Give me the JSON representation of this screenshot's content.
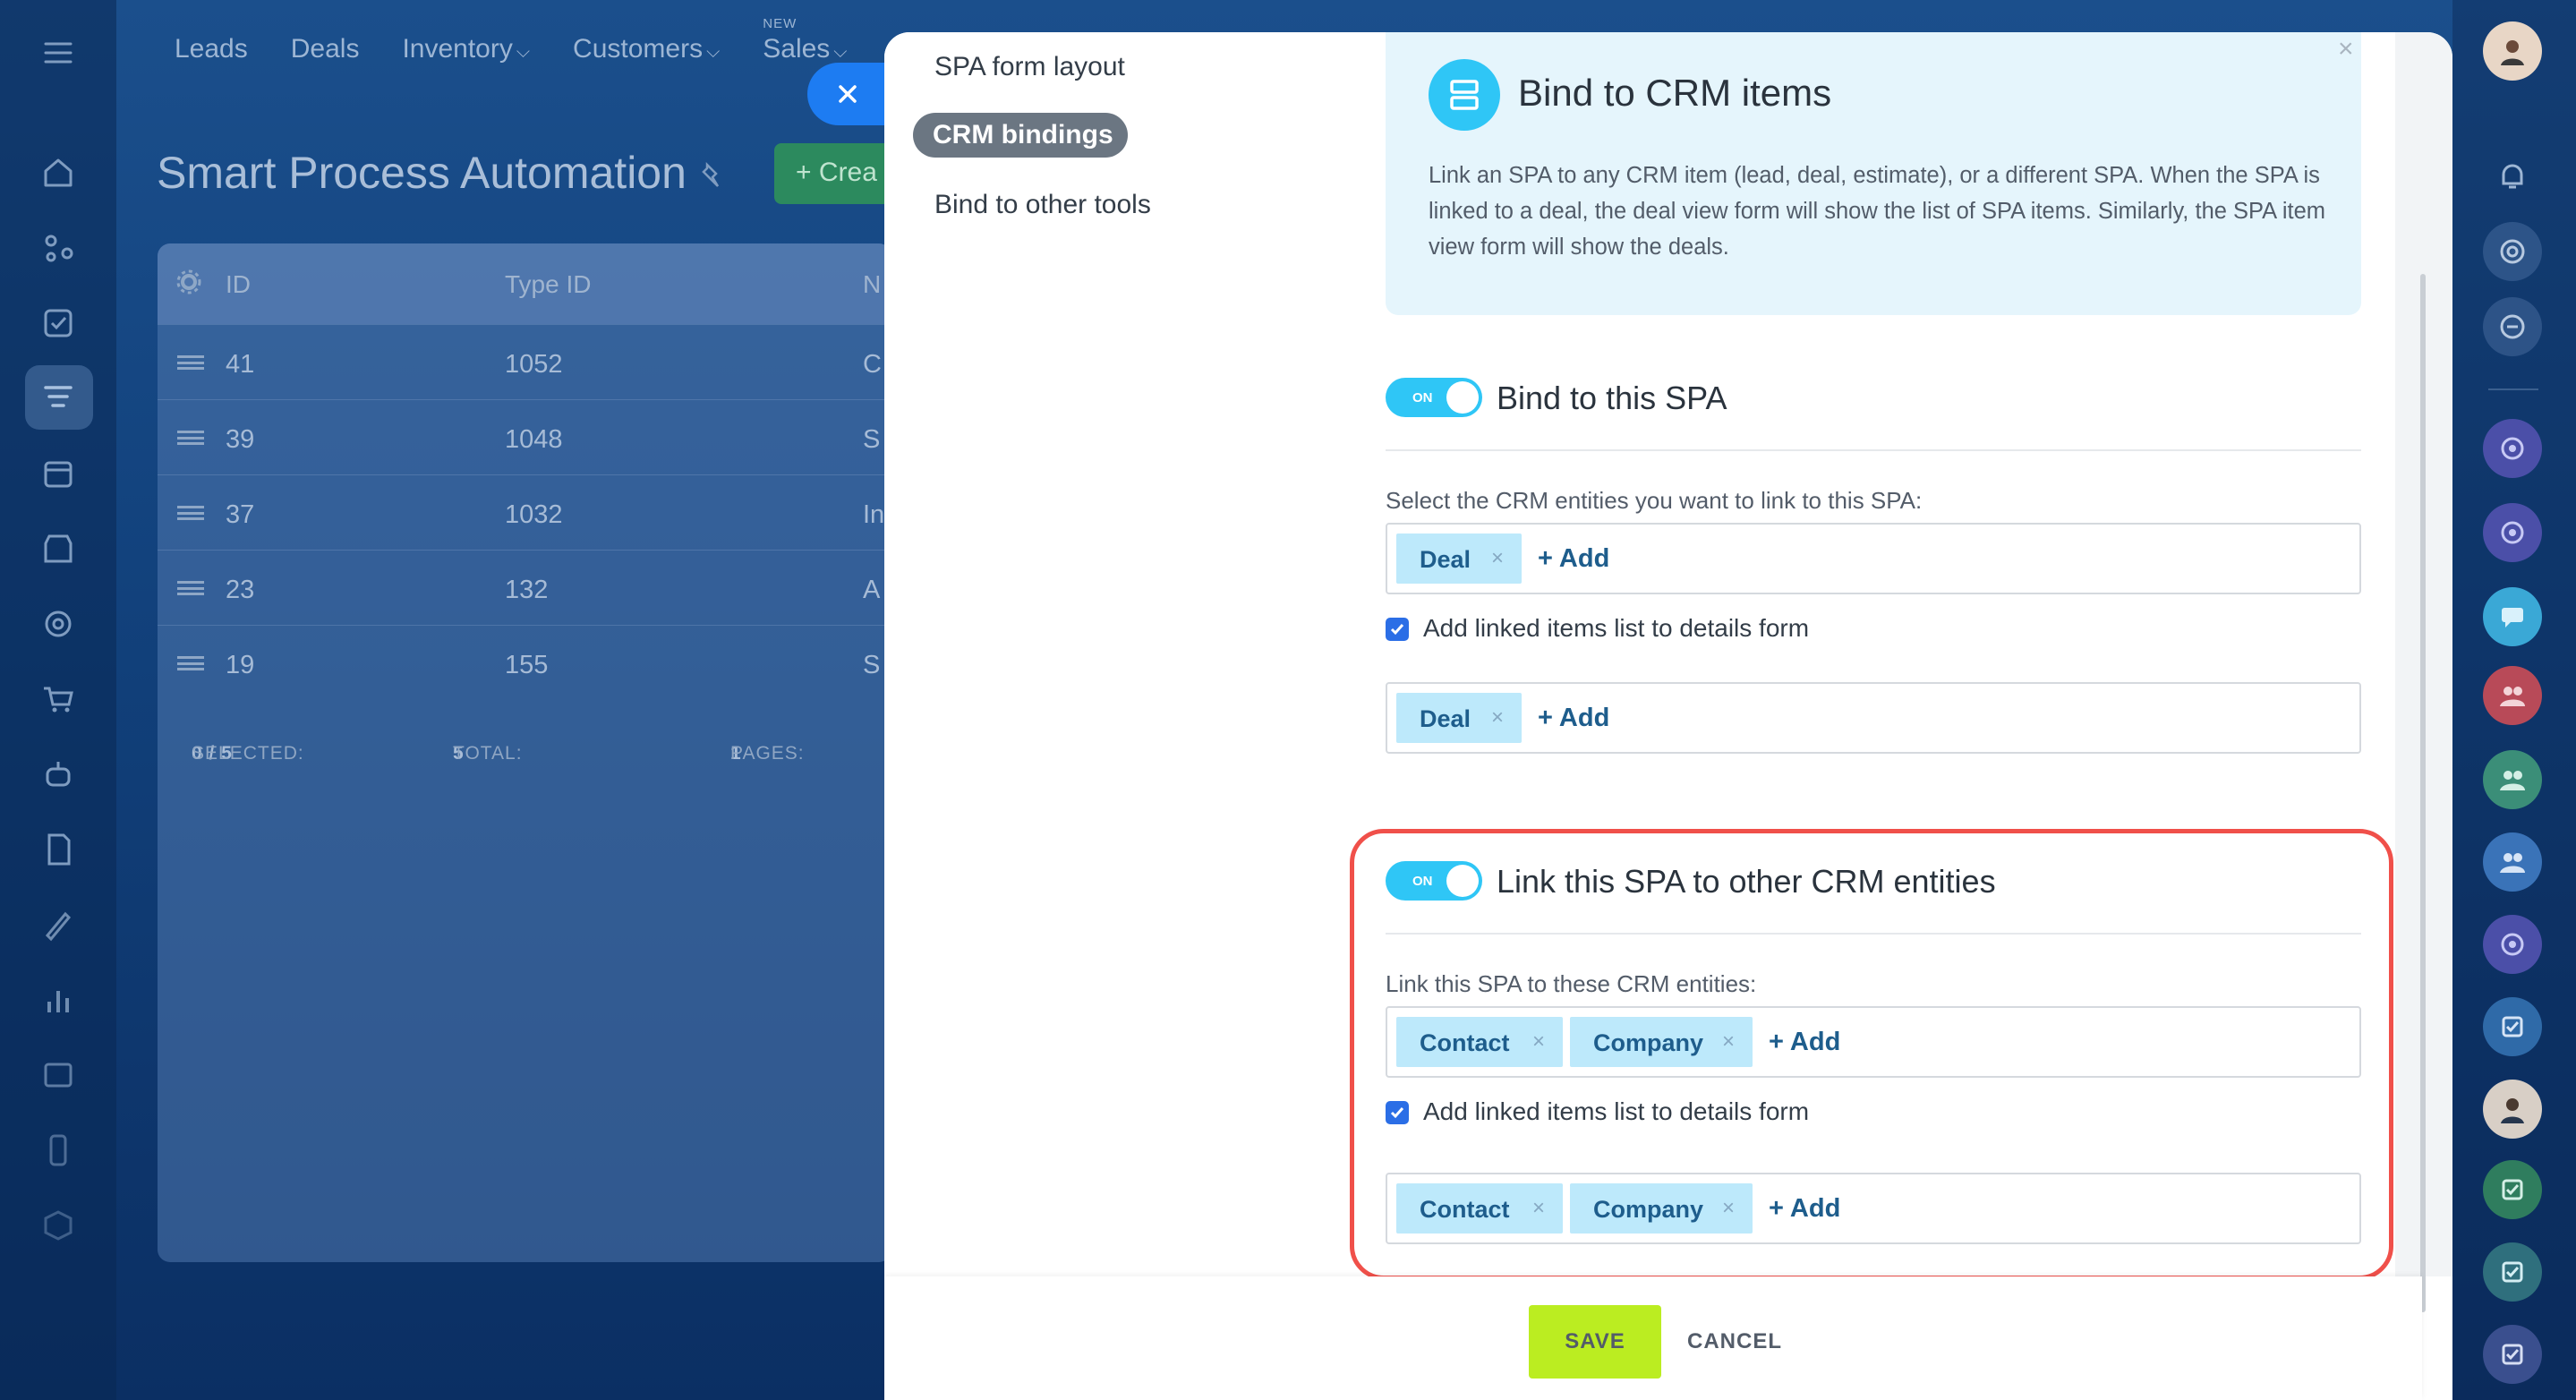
{
  "app": {
    "top_nav": [
      {
        "label": "Leads",
        "dropdown": false,
        "badge": ""
      },
      {
        "label": "Deals",
        "dropdown": false,
        "badge": ""
      },
      {
        "label": "Inventory",
        "dropdown": true,
        "badge": ""
      },
      {
        "label": "Customers",
        "dropdown": true,
        "badge": ""
      },
      {
        "label": "Sales",
        "dropdown": true,
        "badge": "NEW"
      }
    ],
    "page_title": "Smart Process Automation",
    "create_button": "+ Crea",
    "grid": {
      "columns": [
        "ID",
        "Type ID",
        "N"
      ],
      "rows": [
        {
          "id": "41",
          "type_id": "1052",
          "name": "C"
        },
        {
          "id": "39",
          "type_id": "1048",
          "name": "S"
        },
        {
          "id": "37",
          "type_id": "1032",
          "name": "In"
        },
        {
          "id": "23",
          "type_id": "132",
          "name": "A"
        },
        {
          "id": "19",
          "type_id": "155",
          "name": "S"
        }
      ],
      "footer": {
        "selected_label": "SELECTED:",
        "selected_value": "0 / 5",
        "total_label": "TOTAL:",
        "total_value": "5",
        "pages_label": "PAGES:",
        "pages_value": "1"
      }
    }
  },
  "slider": {
    "menu": {
      "items": [
        "SPA form layout",
        "CRM bindings",
        "Bind to other tools"
      ],
      "active": "CRM bindings"
    },
    "info": {
      "icon": "bind-icon",
      "title": "Bind to CRM items",
      "text": "Link an SPA to any CRM item (lead, deal, estimate), or a different SPA. When the SPA is linked to a deal, the deal view form will show the list of SPA items. Similarly, the SPA item view form will show the deals."
    },
    "bind_section": {
      "toggle_label": "ON",
      "title": "Bind to this SPA",
      "field_label": "Select the CRM entities you want to link to this SPA:",
      "tags": [
        "Deal"
      ],
      "add_label": "+ Add",
      "checkbox_label": "Add linked items list to details form",
      "checkbox_checked": true,
      "details_tags": [
        "Deal"
      ],
      "details_add_label": "+ Add"
    },
    "link_section": {
      "toggle_label": "ON",
      "title": "Link this SPA to other CRM entities",
      "field_label": "Link this SPA to these CRM entities:",
      "tags": [
        "Contact",
        "Company"
      ],
      "add_label": "+ Add",
      "checkbox_label": "Add linked items list to details form",
      "checkbox_checked": true,
      "details_tags": [
        "Contact",
        "Company"
      ],
      "details_add_label": "+ Add"
    },
    "footer": {
      "save_label": "SAVE",
      "cancel_label": "CANCEL"
    }
  },
  "colors": {
    "accent": "#2fc6f6",
    "save": "#bbed21",
    "highlight": "#f0504a",
    "tag_bg": "#bde9fb"
  }
}
